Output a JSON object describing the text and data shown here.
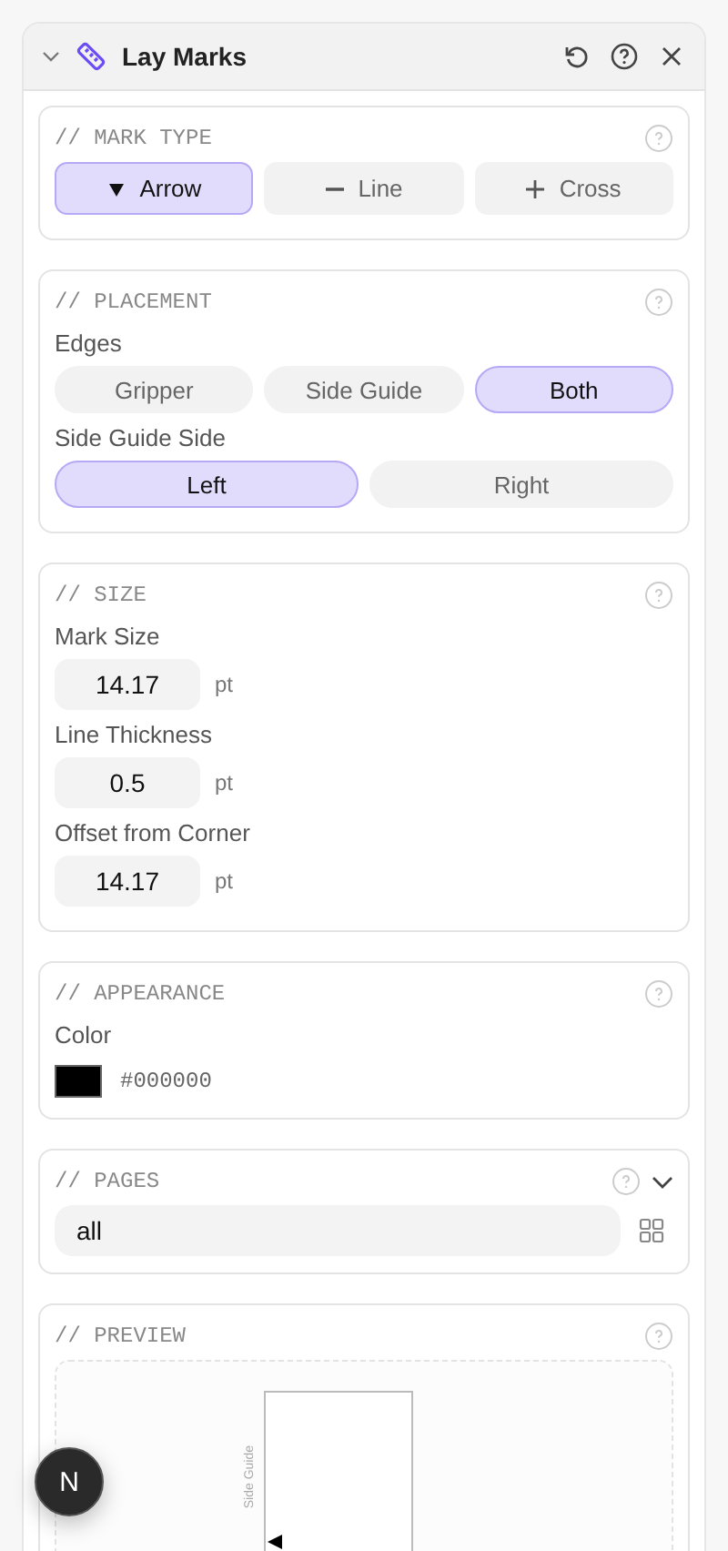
{
  "panel": {
    "title": "Lay Marks",
    "expanded": true
  },
  "sections": [
    {
      "kind": "segments",
      "title": "// MARK TYPE",
      "groups": [
        {
          "options": [
            {
              "label": "Arrow",
              "kind": "arrow",
              "selected": true
            },
            {
              "label": "Line",
              "kind": "line",
              "selected": false
            },
            {
              "label": "Cross",
              "kind": "cross",
              "selected": false
            }
          ]
        }
      ]
    },
    {
      "kind": "segments",
      "title": "// PLACEMENT",
      "groups": [
        {
          "label": "Edges",
          "options": [
            {
              "label": "Gripper",
              "selected": false
            },
            {
              "label": "Side Guide",
              "selected": false
            },
            {
              "label": "Both",
              "selected": true
            }
          ]
        },
        {
          "label": "Side Guide Side",
          "options": [
            {
              "label": "Left",
              "selected": true
            },
            {
              "label": "Right",
              "selected": false
            }
          ]
        }
      ]
    },
    {
      "kind": "fields",
      "title": "// SIZE",
      "fields": [
        {
          "label": "Mark Size",
          "value": "14.17",
          "unit": "pt"
        },
        {
          "label": "Line Thickness",
          "value": "0.5",
          "unit": "pt"
        },
        {
          "label": "Offset from Corner",
          "value": "14.17",
          "unit": "pt"
        }
      ]
    },
    {
      "kind": "color",
      "title": "// APPEARANCE",
      "label": "Color",
      "value": "#000000"
    },
    {
      "kind": "pages",
      "title": "// PAGES",
      "value": "all"
    },
    {
      "kind": "preview",
      "title": "// PREVIEW",
      "side_label": "Side Guide"
    }
  ],
  "fab": {
    "label": "N"
  }
}
